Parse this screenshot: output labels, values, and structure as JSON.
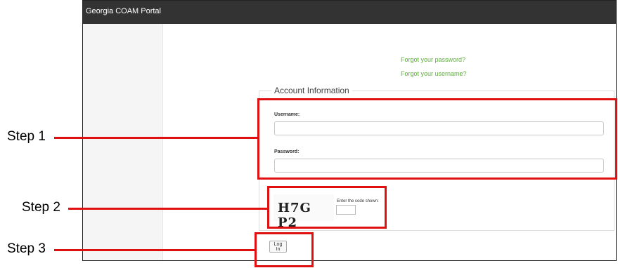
{
  "app": {
    "title": "Georgia COAM Portal"
  },
  "links": {
    "forgot_password": "Forgot your password?",
    "forgot_username": "Forgot your username?"
  },
  "form": {
    "legend": "Account Information",
    "username_label": "Username:",
    "username_value": "",
    "password_label": "Password:",
    "password_value": "",
    "captcha_image_text": "H7G P2",
    "captcha_label": "Enter the code shown:",
    "captcha_value": "",
    "login_label": "Log In"
  },
  "annotations": {
    "step1": "Step 1",
    "step2": "Step 2",
    "step3": "Step 3",
    "color": "#e01010"
  }
}
